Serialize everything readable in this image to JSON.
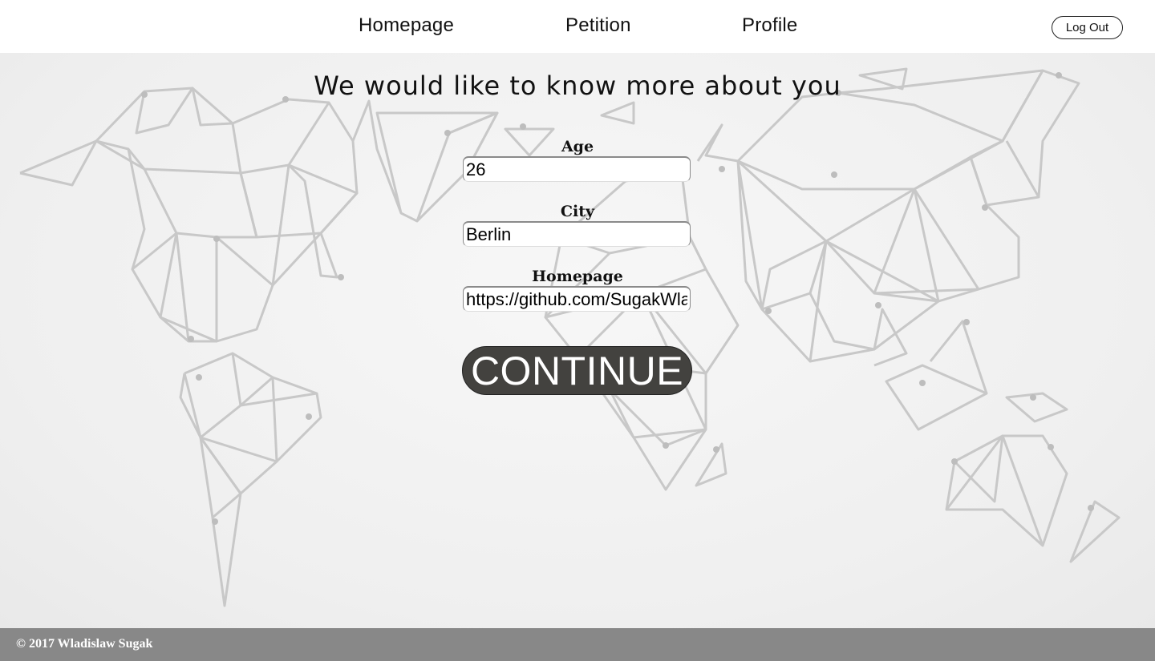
{
  "nav": {
    "links": [
      "Homepage",
      "Petition",
      "Profile"
    ],
    "logout_label": "Log Out"
  },
  "main": {
    "headline": "We would like to know more about you",
    "form": {
      "age": {
        "label": "Age",
        "value": "26"
      },
      "city": {
        "label": "City",
        "value": "Berlin"
      },
      "homepage": {
        "label": "Homepage",
        "value": "https://github.com/SugakWladislaw"
      }
    },
    "continue_label": "CONTINUE"
  },
  "footer": {
    "copyright": "© 2017 Wladislaw Sugak"
  },
  "colors": {
    "header_bg": "#ffffff",
    "button_bg": "#43423f",
    "footer_bg": "#888888",
    "map_lines": "#c8c8c8"
  },
  "icons": {
    "background": "world-map-wireframe"
  }
}
